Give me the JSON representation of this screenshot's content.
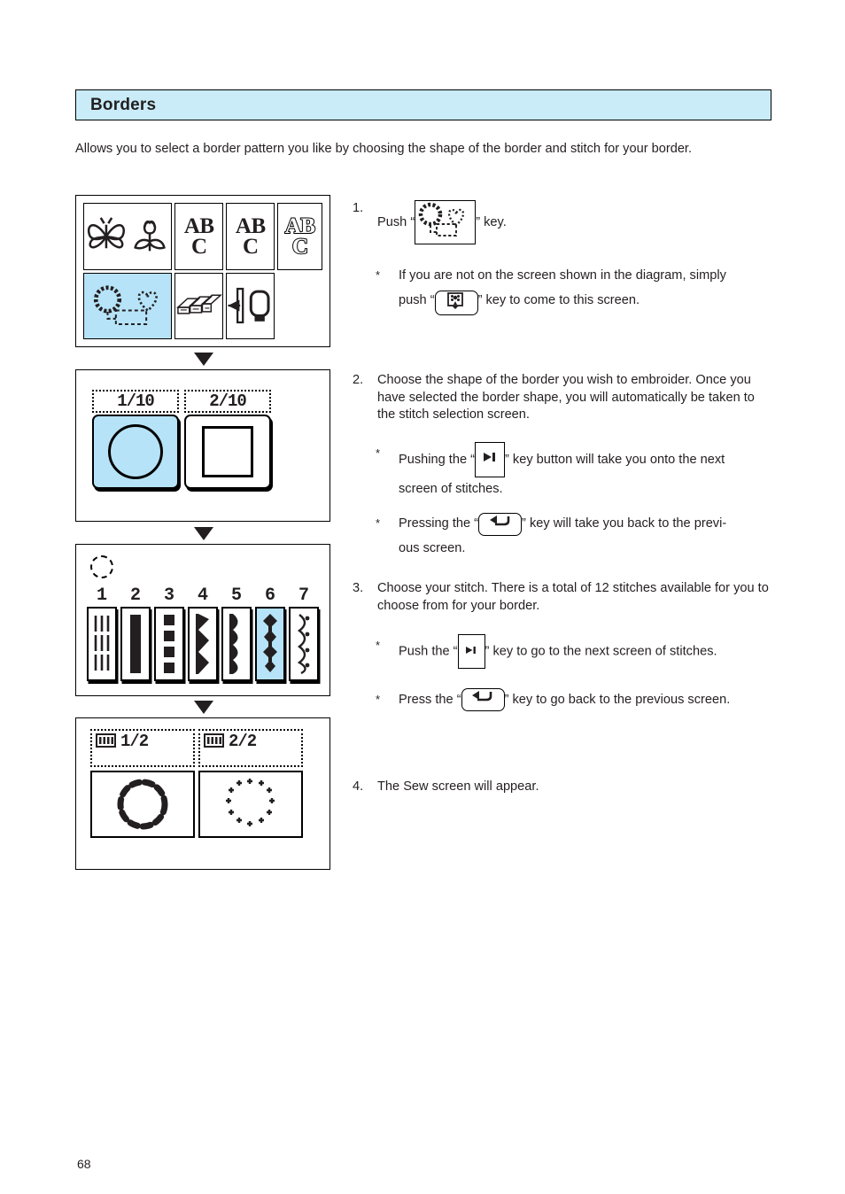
{
  "page": {
    "number": "68",
    "header_title": "Borders",
    "header_bg": "#c9ecf8",
    "highlight_color": "#b6e3f8",
    "ink_color": "#231f20",
    "intro": "Allows you to select a border pattern you like by choosing the shape of the border and stitch for your border."
  },
  "screens": {
    "menu_screen": {
      "name": "embroidery-main-menu",
      "cells": [
        {
          "id": "butterfly-flower",
          "icon": "butterfly-tulip-icon",
          "label": "",
          "selected": false
        },
        {
          "id": "lettering-1",
          "icon": "abc-block-icon",
          "label_line1": "AB",
          "label_line2": "C",
          "style": "solid",
          "selected": false
        },
        {
          "id": "lettering-2",
          "icon": "abc-block-icon",
          "label_line1": "AB",
          "label_line2": "C",
          "style": "solid",
          "selected": false
        },
        {
          "id": "lettering-outline",
          "icon": "abc-outline-icon",
          "label_line1": "AB",
          "label_line2": "C",
          "style": "outline",
          "selected": false
        },
        {
          "id": "borders",
          "icon": "border-circle-heart-icon",
          "label": "",
          "selected": true
        },
        {
          "id": "quilting",
          "icon": "quilt-blocks-icon",
          "label": "",
          "selected": false
        },
        {
          "id": "hoop-setting",
          "icon": "hoop-arrow-icon",
          "label": "",
          "selected": false
        }
      ]
    },
    "shape_screen": {
      "name": "border-shape-select",
      "options": [
        {
          "page_label": "1/10",
          "shape": "circle",
          "selected": true
        },
        {
          "page_label": "2/10",
          "shape": "square",
          "selected": false
        }
      ]
    },
    "stitch_screen": {
      "name": "border-stitch-select",
      "shape_indicator": "circle-outline-icon",
      "stitches": [
        {
          "number": "1",
          "pattern": "triple-straight",
          "selected": false
        },
        {
          "number": "2",
          "pattern": "solid-satin",
          "selected": false
        },
        {
          "number": "3",
          "pattern": "dashed-blocks",
          "selected": false
        },
        {
          "number": "4",
          "pattern": "zigzag-points",
          "selected": false
        },
        {
          "number": "5",
          "pattern": "scallop",
          "selected": false
        },
        {
          "number": "6",
          "pattern": "diamond-beads",
          "selected": true
        },
        {
          "number": "7",
          "pattern": "wave-dots",
          "selected": false
        }
      ]
    },
    "sew_screen": {
      "name": "sew-screen",
      "sections": [
        {
          "spool_icon": "thread-spool-icon",
          "label": "1/2",
          "preview": "dashed-circle-border"
        },
        {
          "spool_icon": "thread-spool-icon",
          "label": "2/2",
          "preview": "cross-dot-circle-border"
        }
      ]
    }
  },
  "steps": [
    {
      "number": "1.",
      "text_before_key": "Push “",
      "key_icon": "border-pattern-key-icon",
      "text_after_key": "” key.",
      "notes": [
        {
          "star": "*",
          "part1": "If you are not on the screen shown in the diagram, simply",
          "part2_before": "push “",
          "key_icon": "embroidery-mode-key-icon",
          "part2_after": "” key to come to this screen."
        }
      ]
    },
    {
      "number": "2.",
      "text": "Choose the shape of the border you wish to embroider.  Once you have selected the border shape, you will automatically be taken to the stitch selection screen.",
      "notes": [
        {
          "star": "*",
          "before": "Pushing the “",
          "key_glyph": "▶❘",
          "key_name": "next-screen-key-icon",
          "after": "” key button will take you onto the next",
          "continuation": "screen of stitches."
        },
        {
          "star": "*",
          "before": "Pressing the “",
          "key_glyph": "↵",
          "key_name": "return-key-icon",
          "after": "” key will take you back to the previ-",
          "continuation": "ous screen."
        }
      ]
    },
    {
      "number": "3.",
      "text": "Choose your stitch.  There is a total of 12 stitches available for you to choose from for your border.",
      "notes": [
        {
          "star": "*",
          "before": "Push the “",
          "key_glyph": "▶❘",
          "key_name": "next-screen-key-icon",
          "after": "” key to go to the next screen of stitches."
        },
        {
          "star": "*",
          "before": "Press the “",
          "key_glyph": "↵",
          "key_name": "return-key-icon",
          "after": "” key to go back to the previous screen."
        }
      ]
    },
    {
      "number": "4.",
      "text": "The Sew screen will appear."
    }
  ]
}
